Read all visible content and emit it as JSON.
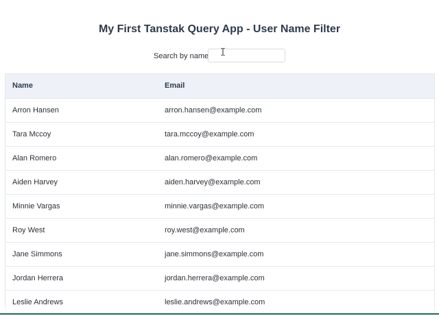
{
  "page": {
    "title": "My First Tanstak Query App - User Name Filter"
  },
  "search": {
    "label": "Search by name:",
    "value": "",
    "placeholder": ""
  },
  "table": {
    "headers": {
      "name": "Name",
      "email": "Email"
    },
    "rows": [
      {
        "name": "Arron Hansen",
        "email": "arron.hansen@example.com"
      },
      {
        "name": "Tara Mccoy",
        "email": "tara.mccoy@example.com"
      },
      {
        "name": "Alan Romero",
        "email": "alan.romero@example.com"
      },
      {
        "name": "Aiden Harvey",
        "email": "aiden.harvey@example.com"
      },
      {
        "name": "Minnie Vargas",
        "email": "minnie.vargas@example.com"
      },
      {
        "name": "Roy West",
        "email": "roy.west@example.com"
      },
      {
        "name": "Jane Simmons",
        "email": "jane.simmons@example.com"
      },
      {
        "name": "Jordan Herrera",
        "email": "jordan.herrera@example.com"
      },
      {
        "name": "Leslie Andrews",
        "email": "leslie.andrews@example.com"
      }
    ]
  },
  "icons": {
    "cursor": "text-cursor-icon"
  },
  "colors": {
    "header_bg": "#eef2f8",
    "title": "#2f3a4c",
    "border": "#e3e7ec"
  }
}
